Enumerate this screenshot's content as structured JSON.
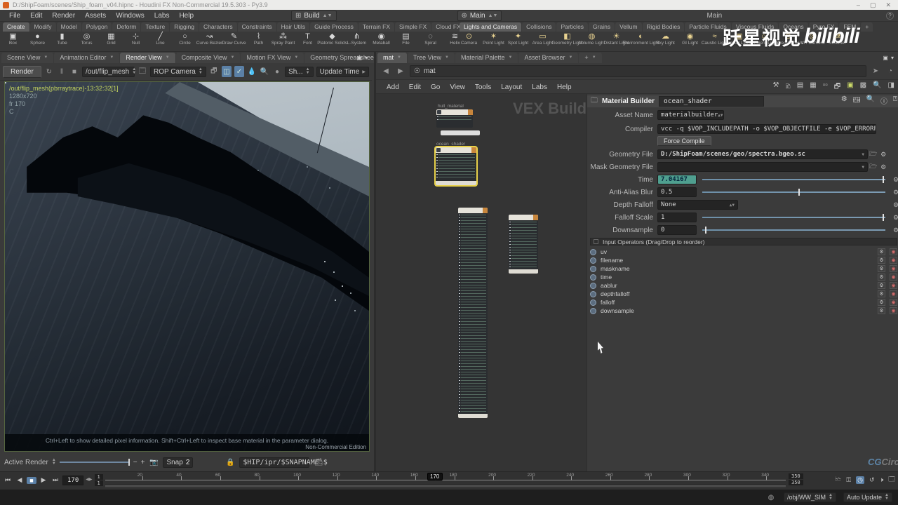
{
  "window": {
    "title": "D:/ShipFoam/scenes/Ship_foam_v04.hipnc - Houdini FX Non-Commercial 19.5.303 - Py3.9",
    "minimize": "–",
    "maximize": "▢",
    "close": "✕"
  },
  "menubar": {
    "items": [
      "File",
      "Edit",
      "Render",
      "Assets",
      "Windows",
      "Labs",
      "Help"
    ],
    "build_desktop": "Build",
    "main_desktop": "Main",
    "main_right": "Main",
    "help_badge": "?"
  },
  "watermark": {
    "cn": "跃星视觉",
    "bilibili": "bilibili",
    "cg_prefix": "CG",
    "cg_rest": "Circ"
  },
  "shelf": {
    "left_tabs": [
      "Create",
      "Modify",
      "Model",
      "Polygon",
      "Deform",
      "Texture",
      "Rigging",
      "Characters",
      "Constraints",
      "Hair Utils",
      "Guide Process",
      "Terrain FX",
      "Simple FX",
      "Cloud FX",
      "Volume",
      "+"
    ],
    "right_tabs": [
      "Lights and Cameras",
      "Collisions",
      "Particles",
      "Grains",
      "Vellum",
      "Rigid Bodies",
      "Particle Fluids",
      "Viscous Fluids",
      "Oceans",
      "Pyro FX",
      "FEM",
      "+"
    ],
    "left_tools": [
      {
        "label": "Box",
        "glyph": "▣"
      },
      {
        "label": "Sphere",
        "glyph": "●"
      },
      {
        "label": "Tube",
        "glyph": "▮"
      },
      {
        "label": "Torus",
        "glyph": "◎"
      },
      {
        "label": "Grid",
        "glyph": "▦"
      },
      {
        "label": "Null",
        "glyph": "⊹"
      },
      {
        "label": "Line",
        "glyph": "╱"
      },
      {
        "label": "Circle",
        "glyph": "○"
      },
      {
        "label": "Curve Bezier",
        "glyph": "↝"
      },
      {
        "label": "Draw Curve",
        "glyph": "✎"
      },
      {
        "label": "Path",
        "glyph": "⌇"
      },
      {
        "label": "Spray Paint",
        "glyph": "⁂"
      },
      {
        "label": "Font",
        "glyph": "T"
      },
      {
        "label": "Platonic Solids",
        "glyph": "◆"
      },
      {
        "label": "L-System",
        "glyph": "⋔"
      },
      {
        "label": "Metaball",
        "glyph": "◉"
      },
      {
        "label": "File",
        "glyph": "▤"
      },
      {
        "label": "Spiral",
        "glyph": "◌"
      },
      {
        "label": "Helix",
        "glyph": "≋"
      }
    ],
    "right_tools": [
      {
        "label": "Camera",
        "glyph": "⊙"
      },
      {
        "label": "Point Light",
        "glyph": "✶"
      },
      {
        "label": "Spot Light",
        "glyph": "✦"
      },
      {
        "label": "Area Light",
        "glyph": "▭"
      },
      {
        "label": "Geometry Light",
        "glyph": "◧"
      },
      {
        "label": "Volume Light",
        "glyph": "◍"
      },
      {
        "label": "Distant Light",
        "glyph": "☀"
      },
      {
        "label": "Environment Light",
        "glyph": "◐"
      },
      {
        "label": "Sky Light",
        "glyph": "☁"
      },
      {
        "label": "GI Light",
        "glyph": "◉"
      },
      {
        "label": "Caustic Light",
        "glyph": "≈"
      },
      {
        "label": "Portal Light",
        "glyph": "▣"
      },
      {
        "label": "Ambient Light",
        "glyph": "○"
      },
      {
        "label": "Stereo Camera",
        "glyph": "⊚"
      },
      {
        "label": "VR Camera",
        "glyph": "◎"
      },
      {
        "label": "Switcher",
        "glyph": "⇄"
      }
    ]
  },
  "left_pane": {
    "tabs": [
      "Scene View",
      "Animation Editor",
      "Render View",
      "Composite View",
      "Motion FX View",
      "Geometry Spreadsheet",
      "+"
    ],
    "toolbar": {
      "render": "Render",
      "rop_path": "/out/flip_mesh",
      "camera": "ROP Camera",
      "sh": "Sh...",
      "update_mode": "Update Time"
    },
    "viewport": {
      "line1": "/out/flip_mesh(pbrraytrace)-13:32:32[1]",
      "line2": "1280x720",
      "line3": "fr 170",
      "line4": "C",
      "hint": "Ctrl+Left to show detailed pixel information. Shift+Ctrl+Left to inspect base material in the parameter dialog.",
      "edition": "Non-Commercial Edition"
    },
    "bottom": {
      "active_render": "Active Render",
      "minus": "−",
      "plus": "+",
      "snap_label": "Snap",
      "snap_value": "2",
      "snapshot_path": "$HIP/ipr/$SNAPNAME.$"
    }
  },
  "right_pane": {
    "tabs": [
      "mat",
      "Tree View",
      "Material Palette",
      "Asset Browser",
      "+"
    ],
    "path": "mat",
    "netmenu": [
      "Add",
      "Edit",
      "Go",
      "View",
      "Tools",
      "Layout",
      "Labs",
      "Help"
    ],
    "network": {
      "watermark": "VEX Builder",
      "node1": "hull_material",
      "node2": "ocean_shader"
    }
  },
  "params": {
    "type_label": "Material Builder",
    "node_name": "ocean_shader",
    "asset_name_label": "Asset Name",
    "asset_name_value": "materialbuilder",
    "compiler_label": "Compiler",
    "compiler_value": "vcc -q $VOP_INCLUDEPATH -o $VOP_OBJECTFILE -e $VOP_ERRORFILE $VO",
    "force_compile": "Force Compile",
    "geometry_file_label": "Geometry File",
    "geometry_file_value": "D:/ShipFoam/scenes/geo/spectra.bgeo.sc",
    "mask_geometry_label": "Mask Geometry File",
    "mask_geometry_value": "",
    "time_label": "Time",
    "time_value": "7.04167",
    "time_slider": 99,
    "aablur_label": "Anti-Alias Blur",
    "aablur_value": "0.5",
    "aablur_slider": 53,
    "depthfalloff_label": "Depth Falloff",
    "depthfalloff_value": "None",
    "falloffscale_label": "Falloff Scale",
    "falloffscale_value": "1",
    "falloffscale_slider": 99,
    "downsample_label": "Downsample",
    "downsample_value": "0",
    "downsample_slider": 2,
    "input_ops_header": "Input Operators (Drag/Drop to reorder)",
    "input_ops": [
      "uv",
      "filename",
      "maskname",
      "time",
      "aablur",
      "depthfalloff",
      "falloff",
      "downsample"
    ]
  },
  "timeline": {
    "frame_value": "170",
    "range_start": "1",
    "range_start2": "1",
    "range_end": "350",
    "range_end2": "350",
    "start_num": 1,
    "end_num": 350,
    "playhead_num": 170,
    "playhead_label": "170",
    "ticks": [
      20,
      40,
      60,
      80,
      100,
      120,
      140,
      160,
      180,
      200,
      220,
      240,
      260,
      280,
      300,
      320,
      340
    ]
  },
  "statusbar": {
    "sim_path": "/obj/WW_SIM",
    "update_mode": "Auto Update"
  }
}
